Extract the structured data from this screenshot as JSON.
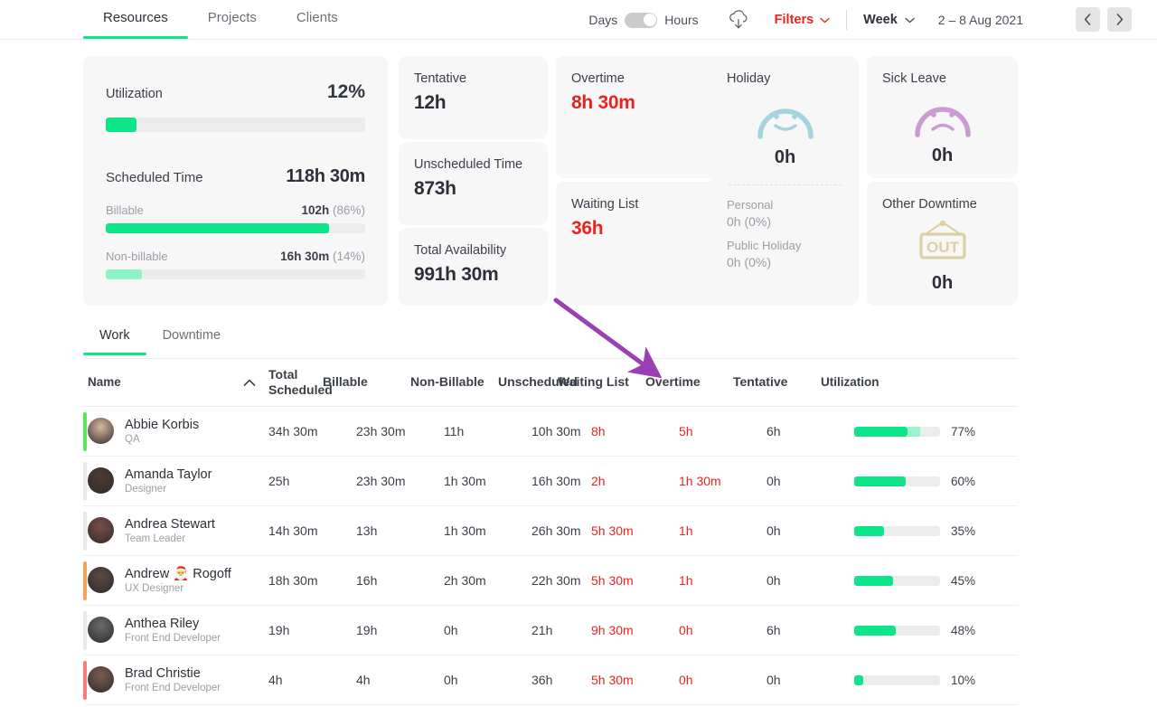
{
  "nav": {
    "tabs": [
      {
        "label": "Resources",
        "active": true
      },
      {
        "label": "Projects",
        "active": false
      },
      {
        "label": "Clients",
        "active": false
      }
    ]
  },
  "toolbar": {
    "days_label": "Days",
    "hours_label": "Hours",
    "toggle_state": "hours",
    "download_icon": "cloud-download-icon",
    "filters_label": "Filters",
    "filters_color": "#e8241f",
    "period_label": "Week",
    "date_range": "2 – 8 Aug 2021",
    "prev_icon": "chevron-left-icon",
    "next_icon": "chevron-right-icon"
  },
  "summary": {
    "utilization": {
      "title": "Utilization",
      "value": "12%",
      "percent": 12
    },
    "scheduled": {
      "title": "Scheduled Time",
      "value": "118h 30m",
      "billable_label": "Billable",
      "billable_value": "102h",
      "billable_percent_text": "(86%)",
      "billable_percent": 86,
      "nonbillable_label": "Non-billable",
      "nonbillable_value": "16h 30m",
      "nonbillable_percent_text": "(14%)",
      "nonbillable_percent": 14
    },
    "tentative": {
      "title": "Tentative",
      "value": "12h"
    },
    "unscheduled": {
      "title": "Unscheduled Time",
      "value": "873h"
    },
    "availability": {
      "title": "Total Availability",
      "value": "991h 30m"
    },
    "overtime": {
      "title": "Overtime",
      "value": "8h 30m",
      "color": "#e8241f"
    },
    "waiting": {
      "title": "Waiting List",
      "value": "36h",
      "color": "#e8241f"
    },
    "holiday": {
      "title": "Holiday",
      "icon": "smiley-face-icon",
      "value": "0h",
      "personal_label": "Personal",
      "personal_value": "0h",
      "personal_percent": "(0%)",
      "public_label": "Public Holiday",
      "public_value": "0h",
      "public_percent": "(0%)"
    },
    "sick": {
      "title": "Sick Leave",
      "icon": "sad-face-icon",
      "value": "0h"
    },
    "other": {
      "title": "Other Downtime",
      "icon": "out-sign-icon",
      "value": "0h"
    }
  },
  "subtabs": [
    {
      "label": "Work",
      "active": true
    },
    {
      "label": "Downtime",
      "active": false
    }
  ],
  "table": {
    "columns": [
      "Name",
      "Total Scheduled",
      "Billable",
      "Non-Billable",
      "Unscheduled",
      "Waiting List",
      "Overtime",
      "Tentative",
      "Utilization"
    ],
    "sort_icon": "chevron-up-icon",
    "rows": [
      {
        "accent": "#5ae65a",
        "name": "Abbie Korbis",
        "role": "QA",
        "total_scheduled": "34h 30m",
        "billable": "23h 30m",
        "non_billable": "11h",
        "unscheduled": "10h 30m",
        "waiting_list": "8h",
        "waiting_list_red": true,
        "overtime": "5h",
        "overtime_red": true,
        "tentative": "6h",
        "util_percent_text": "77%",
        "util_main": 62,
        "util_secondary": 15
      },
      {
        "accent": "#e6e8ea",
        "name": "Amanda Taylor",
        "role": "Designer",
        "total_scheduled": "25h",
        "billable": "23h 30m",
        "non_billable": "1h 30m",
        "unscheduled": "16h 30m",
        "waiting_list": "2h",
        "waiting_list_red": true,
        "overtime": "1h 30m",
        "overtime_red": true,
        "tentative": "0h",
        "util_percent_text": "60%",
        "util_main": 60,
        "util_secondary": 0
      },
      {
        "accent": "#e6e8ea",
        "name": "Andrea Stewart",
        "role": "Team Leader",
        "total_scheduled": "14h 30m",
        "billable": "13h",
        "non_billable": "1h 30m",
        "unscheduled": "26h 30m",
        "waiting_list": "5h 30m",
        "waiting_list_red": true,
        "overtime": "1h",
        "overtime_red": true,
        "tentative": "0h",
        "util_percent_text": "35%",
        "util_main": 35,
        "util_secondary": 0
      },
      {
        "accent": "#f5a25a",
        "name": "Andrew 🎅 Rogoff",
        "role": "UX Designer",
        "total_scheduled": "18h 30m",
        "billable": "16h",
        "non_billable": "2h 30m",
        "unscheduled": "22h 30m",
        "waiting_list": "5h 30m",
        "waiting_list_red": true,
        "overtime": "1h",
        "overtime_red": true,
        "tentative": "0h",
        "util_percent_text": "45%",
        "util_main": 45,
        "util_secondary": 0
      },
      {
        "accent": "#e6e8ea",
        "name": "Anthea Riley",
        "role": "Front End Developer",
        "total_scheduled": "19h",
        "billable": "19h",
        "non_billable": "0h",
        "unscheduled": "21h",
        "waiting_list": "9h 30m",
        "waiting_list_red": true,
        "overtime": "0h",
        "overtime_red": true,
        "tentative": "6h",
        "util_percent_text": "48%",
        "util_main": 48,
        "util_secondary": 0
      },
      {
        "accent": "#f97b7b",
        "name": "Brad Christie",
        "role": "Front End Developer",
        "total_scheduled": "4h",
        "billable": "4h",
        "non_billable": "0h",
        "unscheduled": "36h",
        "waiting_list": "5h 30m",
        "waiting_list_red": true,
        "overtime": "0h",
        "overtime_red": true,
        "tentative": "0h",
        "util_percent_text": "10%",
        "util_main": 10,
        "util_secondary": 0
      }
    ]
  },
  "annotation": {
    "arrow_icon": "purple-arrow-icon",
    "arrow_color": "#9b3fb5",
    "points_to": "Waiting List"
  }
}
